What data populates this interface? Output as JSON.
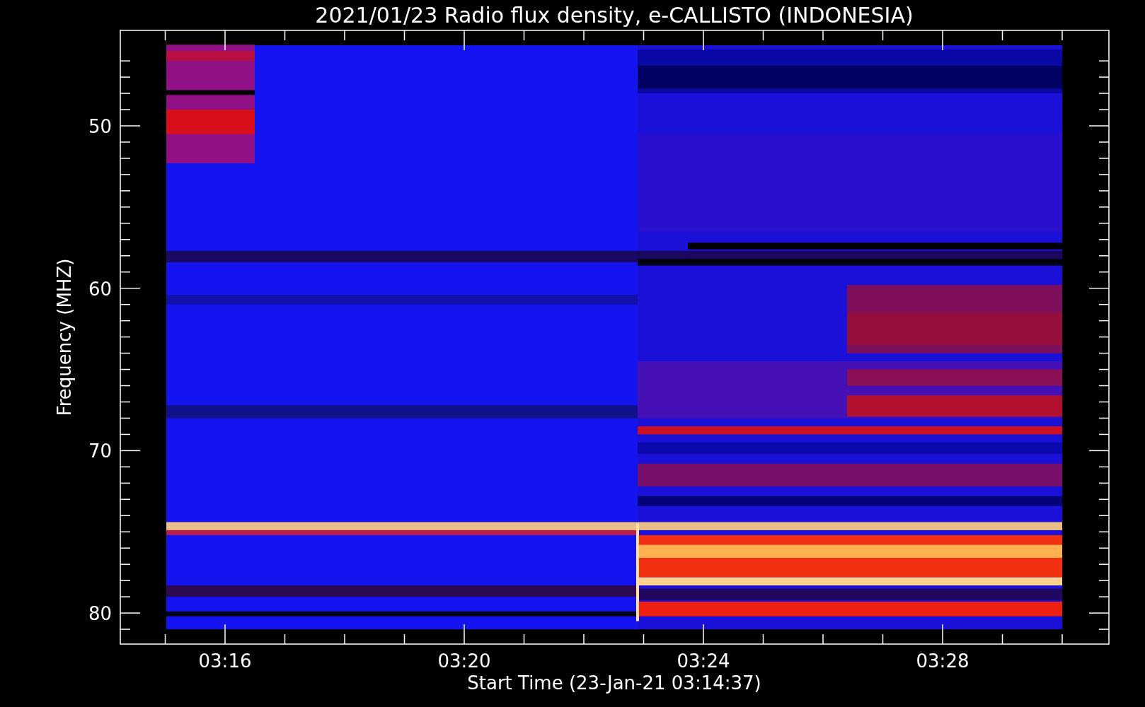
{
  "plot": {
    "title": "2021/01/23  Radio flux density, e-CALLISTO (INDONESIA)",
    "ylabel": "Frequency (MHZ)",
    "yticks": [
      "50",
      "60",
      "70",
      "80"
    ],
    "xticks": [
      "03:16",
      "03:20",
      "03:24",
      "03:28"
    ],
    "xlabel": "Start Time (23-Jan-21 03:14:37)"
  }
}
